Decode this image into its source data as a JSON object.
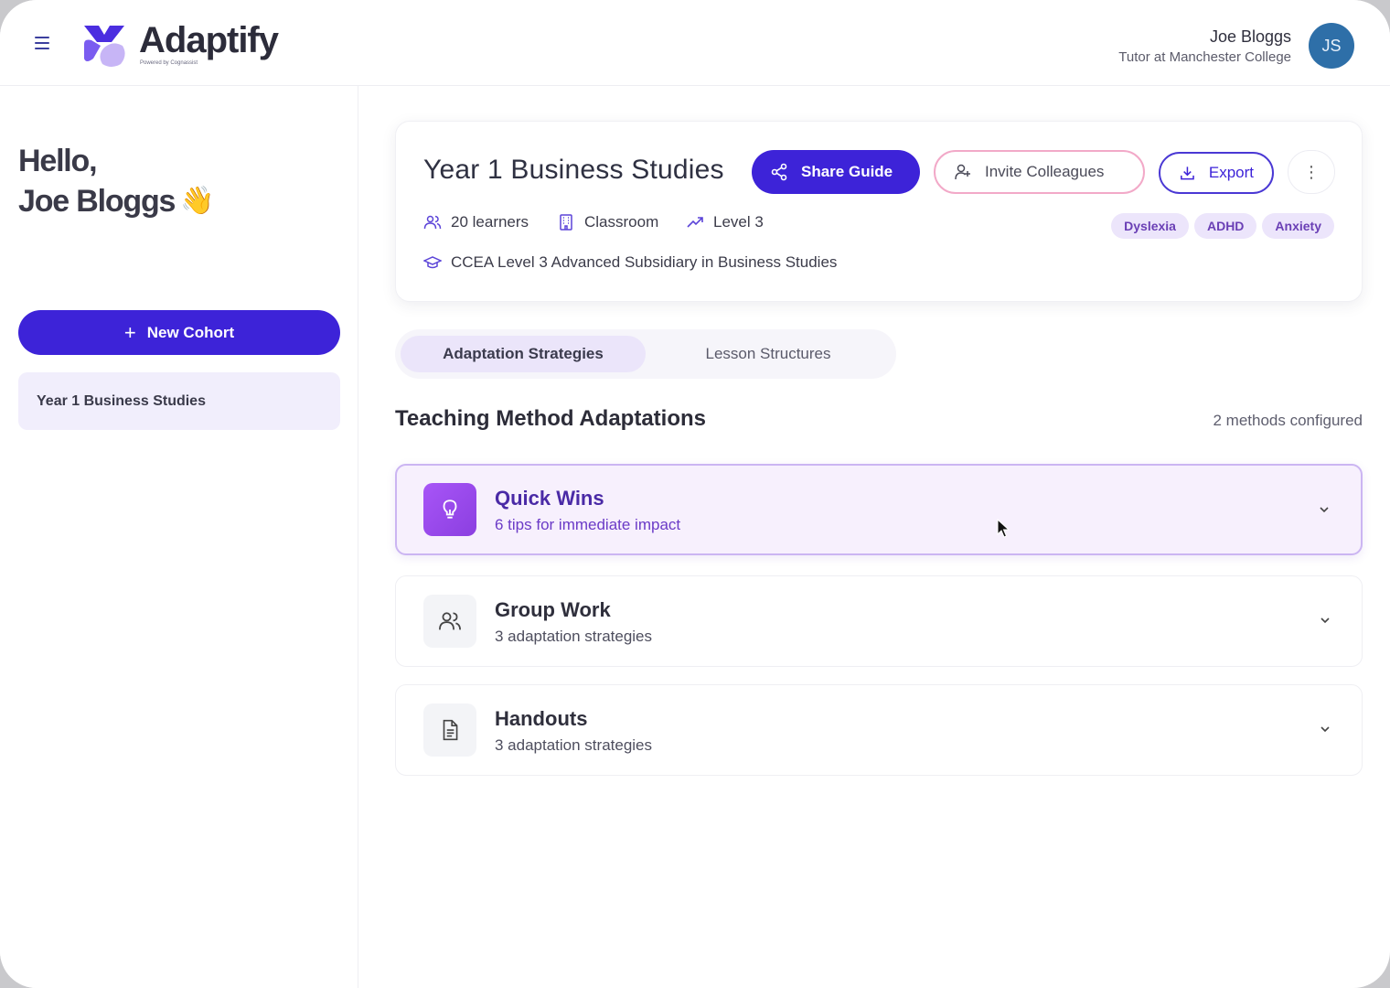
{
  "header": {
    "logo_text": "Adaptify",
    "logo_subtitle": "Powered by Cognassist",
    "user_name": "Joe Bloggs",
    "user_role": "Tutor at Manchester College",
    "avatar_initials": "JS"
  },
  "sidebar": {
    "greeting_line1": "Hello,",
    "greeting_line2": "Joe Bloggs",
    "greeting_emoji": "👋",
    "new_cohort_label": "New Cohort",
    "cohorts": [
      {
        "label": "Year 1 Business Studies",
        "selected": true
      }
    ]
  },
  "cohort_card": {
    "title": "Year 1 Business Studies",
    "share_label": "Share Guide",
    "invite_label": "Invite Colleagues",
    "export_label": "Export",
    "learners": "20 learners",
    "setting": "Classroom",
    "level": "Level 3",
    "qualification": "CCEA Level 3 Advanced Subsidiary in Business Studies",
    "tags": [
      "Dyslexia",
      "ADHD",
      "Anxiety"
    ]
  },
  "tabs": [
    {
      "label": "Adaptation Strategies",
      "active": true
    },
    {
      "label": "Lesson Structures",
      "active": false
    }
  ],
  "section": {
    "title": "Teaching Method Adaptations",
    "count": "2 methods configured"
  },
  "accordions": [
    {
      "title": "Quick Wins",
      "subtitle": "6 tips for immediate impact",
      "icon": "lightbulb-icon",
      "open": true
    },
    {
      "title": "Group Work",
      "subtitle": "3 adaptation strategies",
      "icon": "users-icon",
      "open": false
    },
    {
      "title": "Handouts",
      "subtitle": "3 adaptation strategies",
      "icon": "document-icon",
      "open": false
    }
  ],
  "colors": {
    "primary": "#3d23d8",
    "tag_bg": "#ece5fb",
    "tag_text": "#6a3fb5",
    "invite_border": "#f2a9c8",
    "avatar_bg": "#2e6fa8"
  }
}
